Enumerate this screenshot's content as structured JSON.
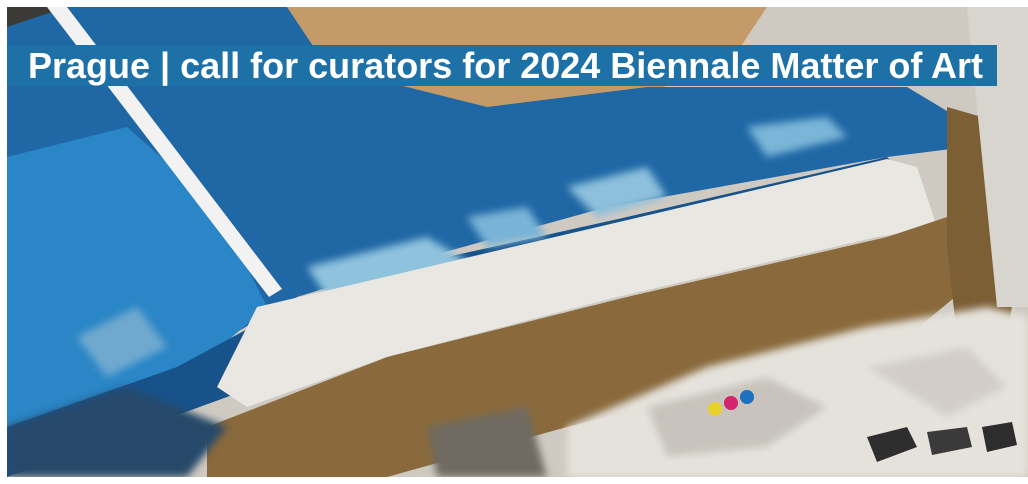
{
  "article": {
    "title": "Prague | call for curators for 2024 Biennale Matter of Art"
  },
  "colors": {
    "title_background": "#1d71a7",
    "title_text": "#ffffff"
  }
}
